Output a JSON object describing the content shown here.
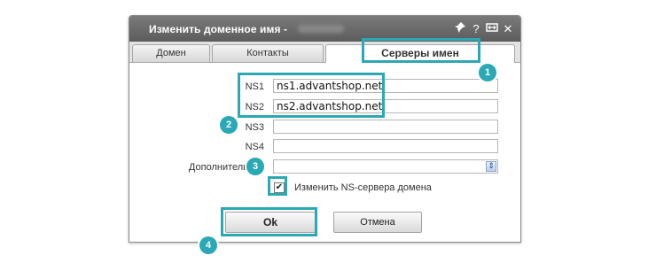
{
  "dialog": {
    "title": "Изменить доменное имя -",
    "icons": {
      "pin": "pin-icon",
      "help": "?",
      "resize": "↔",
      "close": "✕"
    }
  },
  "tabs": [
    {
      "label": "Домен"
    },
    {
      "label": "Контакты"
    },
    {
      "label": "Серверы имен",
      "active": true
    }
  ],
  "form": {
    "ns1": {
      "label": "NS1",
      "value": "ns1.advantshop.net"
    },
    "ns2": {
      "label": "NS2",
      "value": "ns2.advantshop.net"
    },
    "ns3": {
      "label": "NS3",
      "value": ""
    },
    "ns4": {
      "label": "NS4",
      "value": ""
    },
    "extra": {
      "label": "Дополнительные",
      "value": ""
    },
    "change_ns": {
      "label": "Изменить NS-сервера домена",
      "checked": true
    }
  },
  "buttons": {
    "ok": "Ok",
    "cancel": "Отмена"
  },
  "annotations": [
    "1",
    "2",
    "3",
    "4"
  ],
  "colors": {
    "highlight": "#2aa9b5",
    "titlebar": "#6b6b6b"
  }
}
